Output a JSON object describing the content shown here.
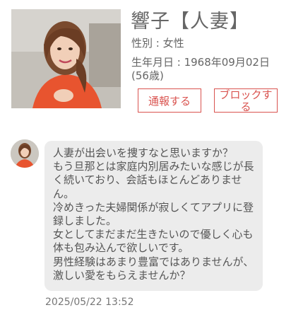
{
  "profile": {
    "name": "響子【人妻】",
    "gender": "性別 : 女性",
    "birth": "生年月日 : 1968年09月02日(56歳)"
  },
  "actions": {
    "report_label": "通報する",
    "block_label": "ブロックする"
  },
  "message": {
    "text": "人妻が出会いを捜すなと思いますか？\nもう旦那とは家庭内別居みたいな感じが長く続いており、会話もほとんどありません。\n冷めきった夫婦関係が寂しくてアプリに登録しました。\n女としてまだまだ生きたいので優しく心も体も包み込んで欲しいです。\n男性経験はあまり豊富ではありませんが、激しい愛をもらえませんか？",
    "timestamp": "2025/05/22 13:52"
  },
  "colors": {
    "accent": "#d9534f",
    "bubble_bg": "#ececec",
    "text": "#555555"
  }
}
